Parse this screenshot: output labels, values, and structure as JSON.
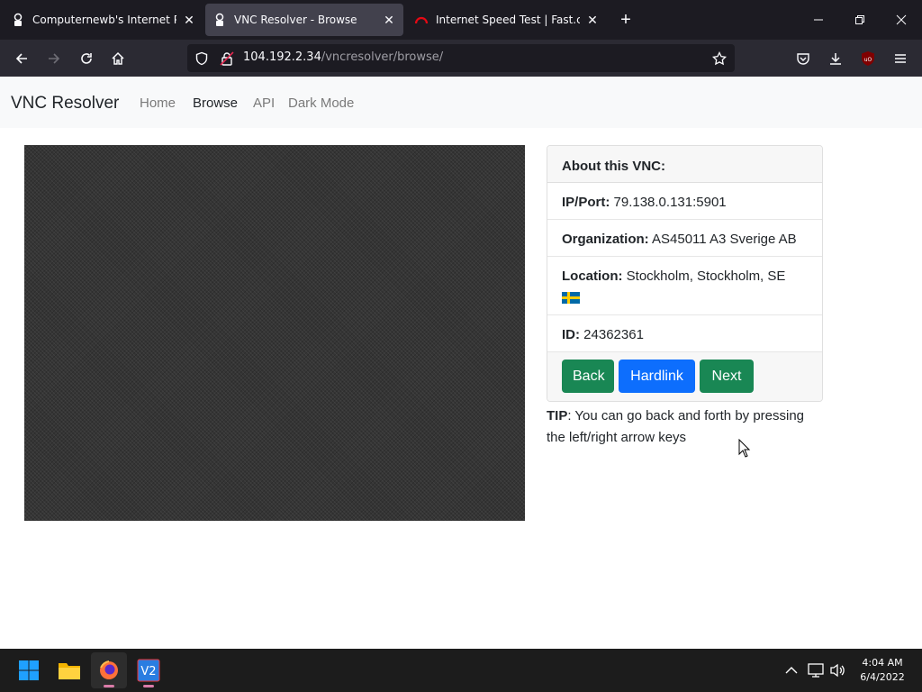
{
  "browser": {
    "tabs": [
      {
        "title": "Computernewb's Internet Pub H",
        "active": false
      },
      {
        "title": "VNC Resolver - Browse",
        "active": true
      },
      {
        "title": "Internet Speed Test | Fast.com",
        "active": false
      }
    ],
    "url_host": "104.192.2.34",
    "url_path": "/vncresolver/browse/",
    "accent": "#2b2a33"
  },
  "site": {
    "brand": "VNC Resolver",
    "nav": [
      "Home",
      "Browse",
      "API",
      "Dark Mode"
    ],
    "active_nav": "Browse"
  },
  "about": {
    "header": "About this VNC:",
    "ip_label": "IP/Port:",
    "ip_value": "79.138.0.131:5901",
    "org_label": "Organization:",
    "org_value": "AS45011 A3 Sverige AB",
    "loc_label": "Location:",
    "loc_value": "Stockholm, Stockholm, SE",
    "id_label": "ID:",
    "id_value": "24362361",
    "buttons": {
      "back": "Back",
      "hardlink": "Hardlink",
      "next": "Next"
    }
  },
  "tip": {
    "label": "TIP",
    "text": ": You can go back and forth by pressing the left/right arrow keys"
  },
  "taskbar": {
    "time": "4:04 AM",
    "date": "6/4/2022"
  },
  "colors": {
    "green": "#198754",
    "blue": "#0d6efd"
  }
}
